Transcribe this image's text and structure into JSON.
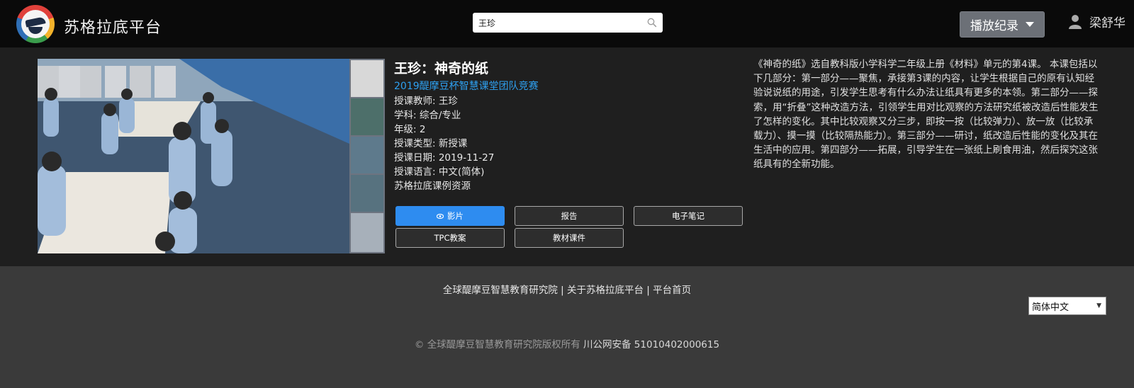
{
  "header": {
    "brand": "苏格拉底平台",
    "search_value": "王珍",
    "history_label": "播放纪录",
    "user_name": "梁舒华"
  },
  "lesson": {
    "title": "王珍：神奇的纸",
    "event": "2019醍摩豆杯智慧课堂团队竞赛",
    "teacher": "授课教师: 王珍",
    "subject": "学科: 综合/专业",
    "grade": "年级: 2",
    "type": "授课类型: 新授课",
    "date": "授课日期: 2019-11-27",
    "language": "授课语言: 中文(简体)",
    "source": "苏格拉底课例资源",
    "buttons": {
      "video": "影片",
      "report": "报告",
      "notes": "电子笔记",
      "tpc": "TPC教案",
      "courseware": "教材课件"
    },
    "description": "《神奇的纸》选自教科版小学科学二年级上册《材料》单元的第4课。 本课包括以下几部分：第一部分——聚焦，承接第3课的内容，让学生根据自己的原有认知经验说说纸的用途，引发学生思考有什么办法让纸具有更多的本领。第二部分——探索，用“折叠”这种改造方法，引领学生用对比观察的方法研究纸被改造后性能发生了怎样的变化。其中比较观察又分三步，即按一按（比较弹力）、放一放（比较承载力）、摸一摸（比较隔热能力）。第三部分——研讨，纸改造后性能的变化及其在生活中的应用。第四部分——拓展，引导学生在一张纸上刷食用油，然后探究这张纸具有的全新功能。"
  },
  "footer": {
    "link1": "全球醍摩豆智慧教育研究院",
    "sep": " | ",
    "link2": "关于苏格拉底平台",
    "link3": "平台首页",
    "language": "简体中文",
    "copyright": "© 全球醍摩豆智慧教育研究院版权所有",
    "icp": "川公网安备 51010402000615"
  },
  "colors": {
    "header_bg": "#0a0a0a",
    "content_bg": "#1f1f1f",
    "page_bg": "#3a3a3a",
    "accent": "#2e8cf0",
    "event_link": "#2ea0f0"
  }
}
